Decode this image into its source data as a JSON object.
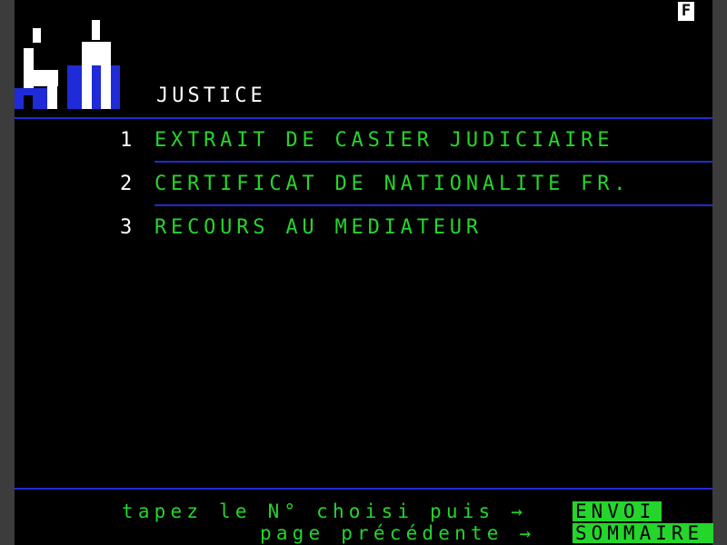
{
  "corner_badge": "F",
  "section": {
    "title": "JUSTICE"
  },
  "menu": {
    "items": [
      {
        "number": "1",
        "label": "EXTRAIT DE CASIER JUDICIAIRE"
      },
      {
        "number": "2",
        "label": "CERTIFICAT DE NATIONALITE FR."
      },
      {
        "number": "3",
        "label": "RECOURS AU MEDIATEUR"
      }
    ]
  },
  "footer": {
    "hint_choose": "tapez le N° choisi puis →",
    "hint_back": "page précédente →",
    "key_send": "ENVOI",
    "key_summary": "SOMMAIRE"
  },
  "colors": {
    "background": "#000000",
    "text_green": "#25d52b",
    "rule_blue": "#1f2bd6",
    "text_white": "#ffffff",
    "gutter_gray": "#3c3c3c"
  },
  "icons": {
    "logo": "justice-figures-icon"
  }
}
